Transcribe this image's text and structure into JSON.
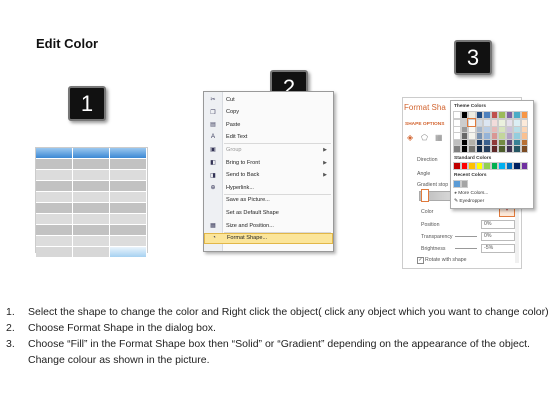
{
  "title": "Edit Color",
  "badges": [
    "1",
    "2",
    "3"
  ],
  "context_menu": {
    "items": [
      {
        "label": "Cut",
        "icon": "scissors-icon",
        "glyph": "✂",
        "disabled": false,
        "submenu": false
      },
      {
        "label": "Copy",
        "icon": "copy-icon",
        "glyph": "❐",
        "disabled": false,
        "submenu": false
      },
      {
        "label": "Paste",
        "icon": "paste-icon",
        "glyph": "▤",
        "disabled": false,
        "submenu": false
      },
      {
        "label": "Edit Text",
        "icon": "edit-text-icon",
        "glyph": "A",
        "disabled": false,
        "submenu": false
      },
      {
        "label": "Group",
        "icon": "group-icon",
        "glyph": "▣",
        "disabled": true,
        "submenu": true
      },
      {
        "label": "Bring to Front",
        "icon": "bring-front-icon",
        "glyph": "◧",
        "disabled": false,
        "submenu": true
      },
      {
        "label": "Send to Back",
        "icon": "send-back-icon",
        "glyph": "◨",
        "disabled": false,
        "submenu": true
      },
      {
        "label": "Hyperlink...",
        "icon": "hyperlink-icon",
        "glyph": "⊕",
        "disabled": false,
        "submenu": false
      },
      {
        "label": "Save as Picture...",
        "icon": "",
        "glyph": "",
        "disabled": false,
        "submenu": false
      },
      {
        "label": "Set as Default Shape",
        "icon": "",
        "glyph": "",
        "disabled": false,
        "submenu": false
      },
      {
        "label": "Size and Position...",
        "icon": "size-position-icon",
        "glyph": "▦",
        "disabled": false,
        "submenu": false
      },
      {
        "label": "Format Shape...",
        "icon": "format-shape-icon",
        "glyph": "◔",
        "disabled": false,
        "submenu": false,
        "highlighted": true
      }
    ]
  },
  "format_panel": {
    "title": "Format Sha",
    "section": "SHAPE OPTIONS",
    "direction": "Direction",
    "angle": "Angle",
    "gradient_stops": "Gradient stop",
    "color": "Color",
    "position": "Position",
    "position_value": "0%",
    "transparency": "Transparency",
    "transparency_value": "0%",
    "brightness": "Brightness",
    "brightness_value": "-5%",
    "rotate_with_shape": "Rotate with shape"
  },
  "color_palette": {
    "theme_colors": "Theme Colors",
    "standard_colors": "Standard Colors",
    "recent_colors": "Recent Colors",
    "more_colors": "More Colors...",
    "eyedropper": "Eyedropper",
    "theme_row": [
      "#ffffff",
      "#000000",
      "#eeece1",
      "#1f497d",
      "#4f81bd",
      "#c0504d",
      "#9bbb59",
      "#8064a2",
      "#4bacc6",
      "#f79646"
    ],
    "standard_row": [
      "#c00000",
      "#ff0000",
      "#ffc000",
      "#ffff00",
      "#92d050",
      "#00b050",
      "#00b0f0",
      "#0070c0",
      "#002060",
      "#7030a0"
    ],
    "recent_row": [
      "#5b9bd5",
      "#a5a5a5"
    ]
  },
  "instructions": [
    {
      "num": "1.",
      "text": "Select the shape to change the color and Right click the object( click any object which you want to change color)"
    },
    {
      "num": "2.",
      "text": "Choose Format Shape in the dialog box."
    },
    {
      "num": "3.",
      "text": "Choose “Fill” in the Format Shape box then “Solid” or “Gradient” depending on the appearance of the object. Change colour as shown in the picture."
    }
  ]
}
